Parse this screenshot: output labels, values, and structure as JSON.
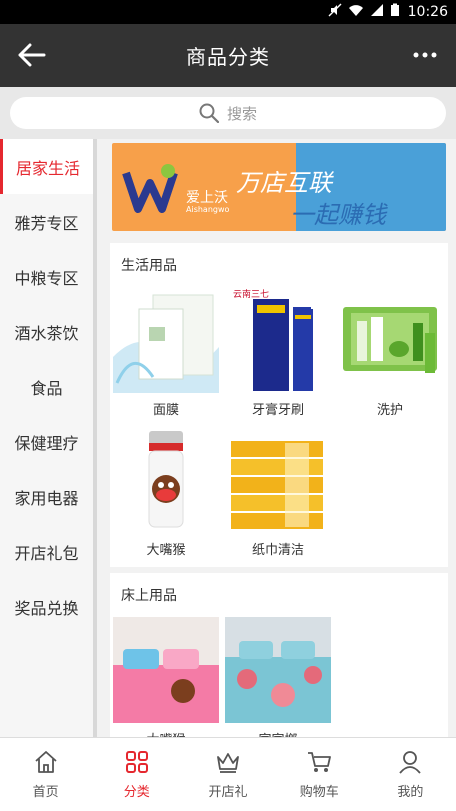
{
  "status": {
    "time": "10:26"
  },
  "appbar": {
    "title": "商品分类",
    "more": "···"
  },
  "search": {
    "placeholder": "搜索"
  },
  "sidebar": {
    "items": [
      {
        "label": "居家生活",
        "active": true
      },
      {
        "label": "雅芳专区"
      },
      {
        "label": "中粮专区"
      },
      {
        "label": "酒水茶饮"
      },
      {
        "label": "食品"
      },
      {
        "label": "保健理疗"
      },
      {
        "label": "家用电器"
      },
      {
        "label": "开店礼包"
      },
      {
        "label": "奖品兑换"
      }
    ]
  },
  "banner": {
    "brand": "爱上沃",
    "brand_sub": "Aishangwo",
    "slogan1": "万店互联",
    "slogan2": "一起赚钱"
  },
  "sections": [
    {
      "title": "生活用品",
      "items": [
        {
          "label": "面膜",
          "icon": "face-mask-product"
        },
        {
          "label": "牙膏牙刷",
          "icon": "toothpaste-product"
        },
        {
          "label": "洗护",
          "icon": "skincare-set-product"
        },
        {
          "label": "大嘴猴",
          "icon": "thermos-product"
        },
        {
          "label": "纸巾清洁",
          "icon": "tissue-boxes-product"
        }
      ]
    },
    {
      "title": "床上用品",
      "items": [
        {
          "label": "大嘴猴",
          "icon": "bedding-pink-product"
        },
        {
          "label": "家家榔",
          "icon": "bedding-floral-product"
        }
      ]
    }
  ],
  "tabbar": {
    "items": [
      {
        "label": "首页",
        "icon": "home-icon"
      },
      {
        "label": "分类",
        "icon": "category-icon",
        "active": true
      },
      {
        "label": "开店礼",
        "icon": "crown-icon"
      },
      {
        "label": "购物车",
        "icon": "cart-icon"
      },
      {
        "label": "我的",
        "icon": "user-icon"
      }
    ]
  },
  "colors": {
    "accent": "#e5282f",
    "appbar": "#333333"
  }
}
